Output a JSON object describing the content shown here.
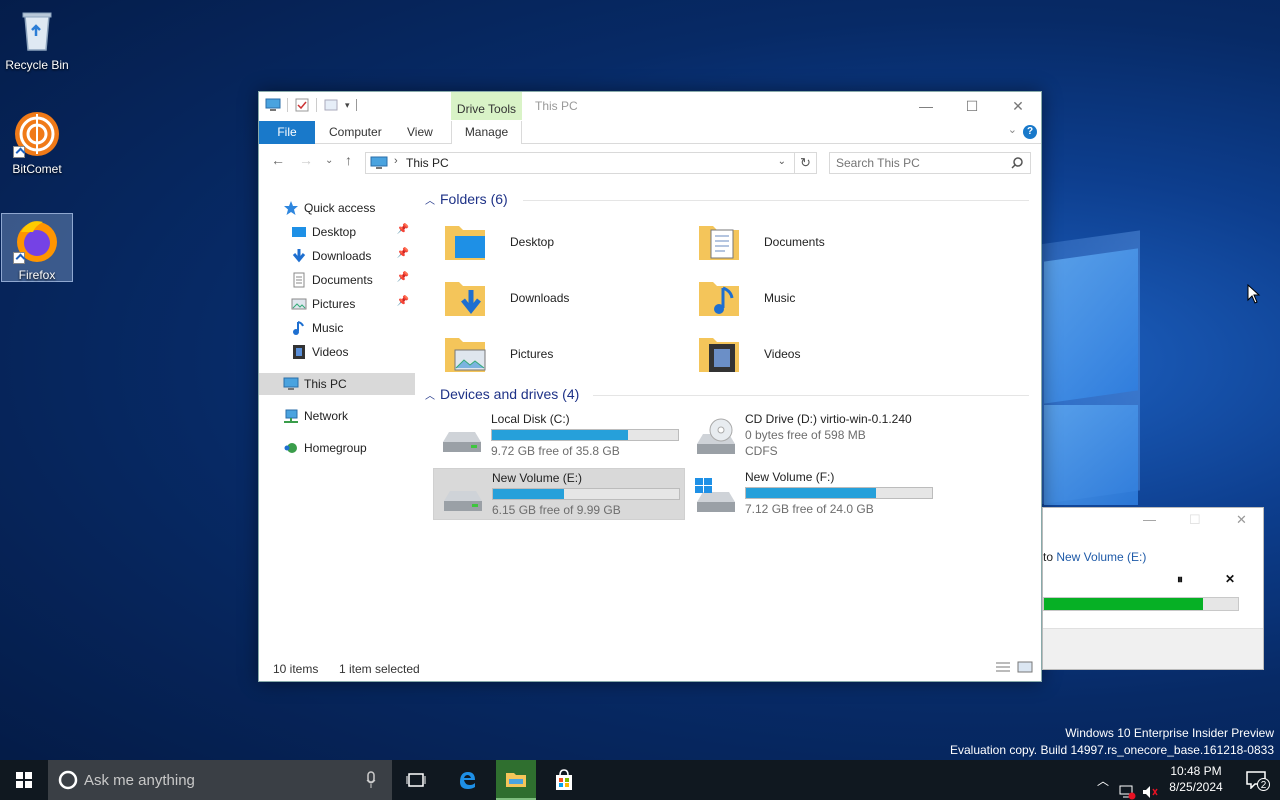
{
  "desktop": {
    "icons": [
      {
        "label": "Recycle Bin"
      },
      {
        "label": "BitComet"
      },
      {
        "label": "Firefox"
      }
    ],
    "watermark": {
      "line1": "Windows 10 Enterprise Insider Preview",
      "line2": "Evaluation copy. Build 14997.rs_onecore_base.161218-0833"
    }
  },
  "explorer": {
    "title": "This PC",
    "context_tab_group": "Drive Tools",
    "ribbon_tabs": [
      "File",
      "Computer",
      "View",
      "Manage"
    ],
    "address": {
      "crumb": "This PC",
      "search_placeholder": "Search This PC"
    },
    "nav": {
      "quick_access": "Quick access",
      "quick_items": [
        {
          "label": "Desktop",
          "pinned": true
        },
        {
          "label": "Downloads",
          "pinned": true
        },
        {
          "label": "Documents",
          "pinned": true
        },
        {
          "label": "Pictures",
          "pinned": true
        },
        {
          "label": "Music",
          "pinned": false
        },
        {
          "label": "Videos",
          "pinned": false
        }
      ],
      "this_pc": "This PC",
      "network": "Network",
      "homegroup": "Homegroup"
    },
    "folders_header": "Folders (6)",
    "folders": [
      {
        "label": "Desktop"
      },
      {
        "label": "Documents"
      },
      {
        "label": "Downloads"
      },
      {
        "label": "Music"
      },
      {
        "label": "Pictures"
      },
      {
        "label": "Videos"
      }
    ],
    "devices_header": "Devices and drives (4)",
    "drives": [
      {
        "name": "Local Disk (C:)",
        "free_text": "9.72 GB free of 35.8 GB",
        "used_fraction": 0.73,
        "icon": "hdd-icon"
      },
      {
        "name": "CD Drive (D:) virtio-win-0.1.240",
        "free_text": "0 bytes free of 598 MB",
        "fs": "CDFS",
        "icon": "cd-drive-icon"
      },
      {
        "name": "New Volume (E:)",
        "free_text": "6.15 GB free of 9.99 GB",
        "used_fraction": 0.38,
        "icon": "hdd-icon",
        "selected": true
      },
      {
        "name": "New Volume (F:)",
        "free_text": "7.12 GB free of 24.0 GB",
        "used_fraction": 0.7,
        "icon": "windows-hdd-icon"
      }
    ],
    "status": {
      "items": "10 items",
      "selected": "1 item selected"
    }
  },
  "copy_dialog": {
    "text_prefix": "to ",
    "destination": "New Volume (E:)",
    "progress_fraction": 0.82,
    "pause_symbol": "⏸",
    "cancel_symbol": "✕"
  },
  "taskbar": {
    "search_placeholder": "Ask me anything",
    "time": "10:48 PM",
    "date": "8/25/2024",
    "notification_count": "2"
  },
  "colors": {
    "accent": "#1979ca",
    "drive_bar": "#26a0da",
    "progress_green": "#06b025",
    "drive_tools_tint": "#d9f3c7"
  }
}
